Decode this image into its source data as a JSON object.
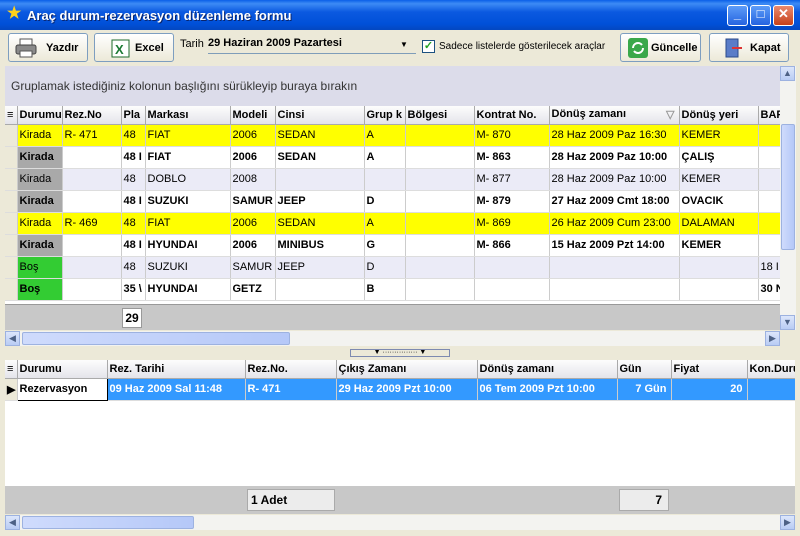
{
  "window": {
    "title": "Araç durum-rezervasyon düzenleme formu"
  },
  "toolbar": {
    "print_label": "Yazdır",
    "excel_label": "Excel",
    "date_label": "Tarih",
    "date_value": "29 Haziran 2009 Pazartesi",
    "checkbox_label": "Sadece listelerde gösterilecek araçlar",
    "refresh_label": "Güncelle",
    "close_label": "Kapat"
  },
  "grid1": {
    "group_hint": "Gruplamak istediğiniz kolonun başlığını sürükleyip buraya bırakın",
    "columns": [
      "Durumu",
      "Rez.No",
      "Pla",
      "Markası",
      "Modeli",
      "Cinsi",
      "Grup k",
      "Bölgesi",
      "Kontrat No.",
      "Dönüş zamanı",
      "Dönüş yeri",
      "BAF"
    ],
    "rows": [
      [
        "Kirada",
        "R-    471",
        "48",
        "FIAT",
        "2006",
        "SEDAN",
        "A",
        "",
        "M-     870",
        "28 Haz 2009 Paz 16:30",
        "KEMER",
        ""
      ],
      [
        "Kirada",
        "",
        "48 I",
        "FIAT",
        "2006",
        "SEDAN",
        "A",
        "",
        "M-    863",
        "28 Haz 2009 Paz 10:00",
        "ÇALIŞ",
        ""
      ],
      [
        "Kirada",
        "",
        "48",
        "DOBLO",
        "2008",
        "",
        "",
        "",
        "M-     877",
        "28 Haz 2009 Paz 10:00",
        "KEMER",
        ""
      ],
      [
        "Kirada",
        "",
        "48 I",
        "SUZUKI",
        "SAMUR",
        "JEEP",
        "D",
        "",
        "M-    879",
        "27 Haz 2009 Cmt 18:00",
        "OVACIK",
        ""
      ],
      [
        "Kirada",
        "R-    469",
        "48",
        "FIAT",
        "2006",
        "SEDAN",
        "A",
        "",
        "M-     869",
        "26 Haz 2009 Cum 23:00",
        "DALAMAN",
        ""
      ],
      [
        "Kirada",
        "",
        "48 I",
        "HYUNDAI",
        "2006",
        "MINIBUS",
        "G",
        "",
        "M-    866",
        "15 Haz 2009 Pzt 14:00",
        "KEMER",
        ""
      ],
      [
        "Boş",
        "",
        "48",
        "SUZUKI",
        "SAMUR",
        "JEEP",
        "D",
        "",
        "",
        "",
        "",
        "18 I"
      ],
      [
        "Boş",
        "",
        "35 \\",
        "HYUNDAI",
        "GETZ",
        "",
        "B",
        "",
        "",
        "",
        "",
        "30 N"
      ]
    ],
    "count": "29"
  },
  "grid2": {
    "columns": [
      "Durumu",
      "Rez. Tarihi",
      "Rez.No.",
      "Çıkış Zamanı",
      "Dönüş zamanı",
      "Gün",
      "Fiyat",
      "Kon.Duru"
    ],
    "rows": [
      [
        "Rezervasyon",
        "09 Haz 2009 Sal 11:48",
        "R-     471",
        "29 Haz 2009 Pzt 10:00",
        "06 Tem 2009 Pzt 10:00",
        "7 Gün",
        "20",
        ""
      ]
    ],
    "footer_count": "1 Adet",
    "footer_days": "7"
  },
  "colors": {
    "selected": "#3399ff",
    "rented_reserved": "#ffff00",
    "free": "#33cc33",
    "titlebar": "#0050d8"
  }
}
